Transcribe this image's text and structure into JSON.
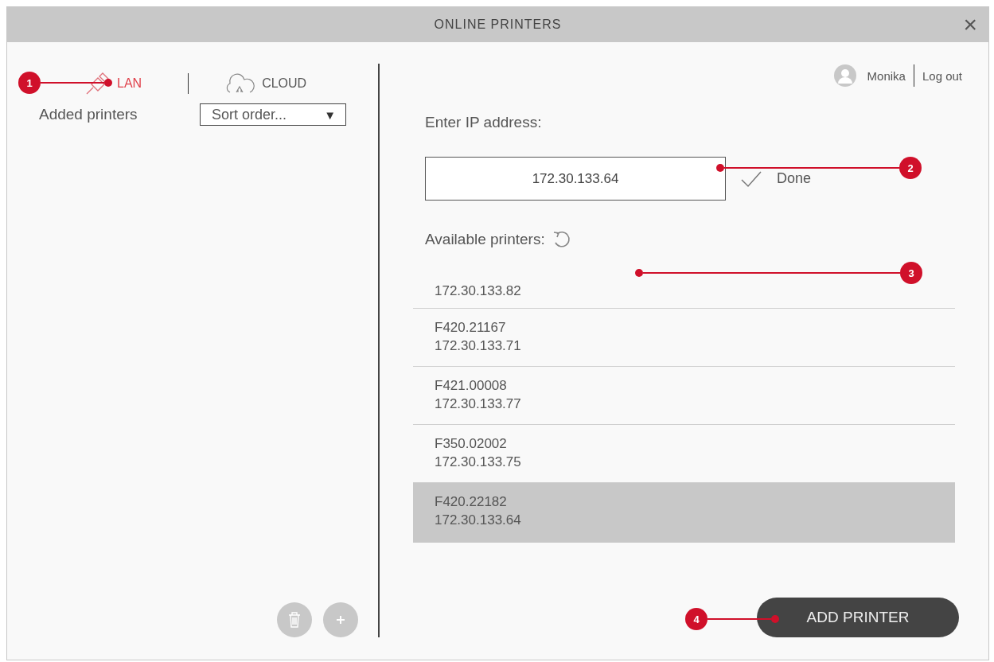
{
  "window": {
    "title": "ONLINE PRINTERS",
    "close": "×"
  },
  "left_panel": {
    "tabs": [
      {
        "label": "LAN",
        "kind": "lan",
        "selected": true
      },
      {
        "label": "CLOUD",
        "kind": "cloud",
        "selected": false
      }
    ],
    "added_printers_label": "Added printers",
    "sort": {
      "value": "Sort order...",
      "arrow": "▼"
    },
    "actions": [
      {
        "kind": "delete",
        "disabled": true
      },
      {
        "kind": "add",
        "disabled": true
      }
    ]
  },
  "user": {
    "name": "Monika",
    "logout": "Log out"
  },
  "ip": {
    "label": "Enter IP address:",
    "value": "172.30.133.64",
    "done": "Done"
  },
  "available": {
    "label": "Available printers:",
    "printers": [
      {
        "ip": "172.30.133.82",
        "selected": false
      },
      {
        "name": "F420.21167",
        "ip": "172.30.133.71",
        "selected": false
      },
      {
        "name": "F421.00008",
        "ip": "172.30.133.77",
        "selected": false
      },
      {
        "name": "F350.02002",
        "ip": "172.30.133.75",
        "selected": false
      },
      {
        "name": "F420.22182",
        "ip": "172.30.133.64",
        "selected": true
      }
    ]
  },
  "add_button": "ADD PRINTER",
  "callouts": [
    {
      "number": "1"
    },
    {
      "number": "2"
    },
    {
      "number": "3"
    },
    {
      "number": "4"
    }
  ]
}
